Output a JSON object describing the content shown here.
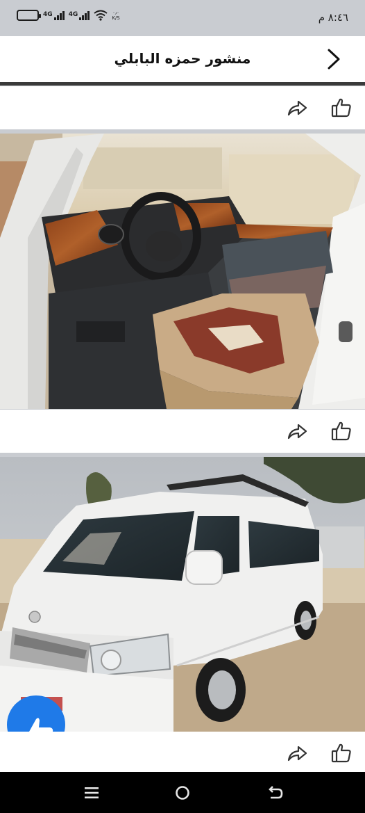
{
  "status_bar": {
    "time": "٨:٤٦ م",
    "battery_label": "",
    "network_1": "4G",
    "network_2": "4G",
    "speed_top": "٠٫٠",
    "speed_unit": "K/S"
  },
  "header": {
    "title": "منشور حمزه البابلي"
  },
  "posts": [
    {
      "kind": "photo",
      "subject": "van-interior"
    },
    {
      "kind": "photo",
      "subject": "white-van-exterior"
    }
  ],
  "colors": {
    "page_bg": "#c9ccd1",
    "header_bg": "#ffffff",
    "accent_blue": "#1f7ae8",
    "icon_dark": "#333333",
    "nav_bg": "#000000"
  },
  "icons": {
    "back": "chevron-right-icon",
    "share": "share-icon",
    "like": "thumbs-up-icon",
    "nav_menu": "menu-icon",
    "nav_home": "home-icon",
    "nav_back": "back-icon"
  }
}
